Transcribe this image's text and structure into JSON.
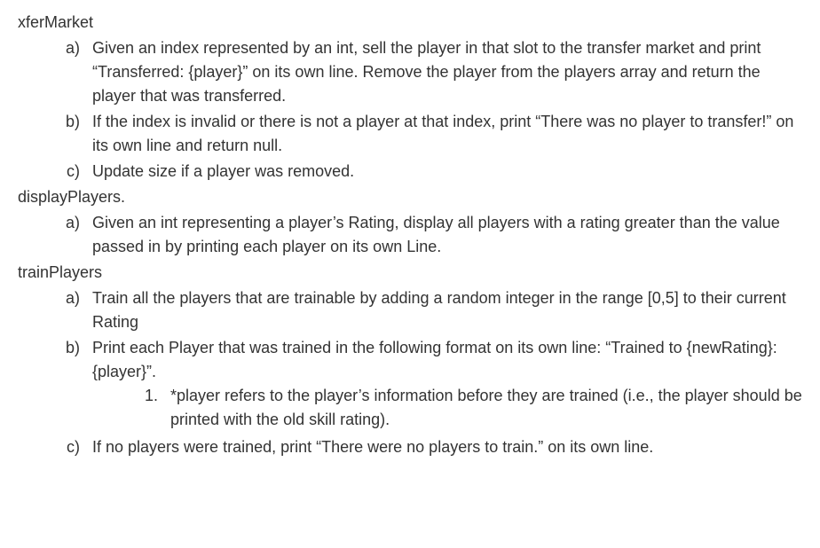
{
  "sections": [
    {
      "title": "xferMarket",
      "items": [
        {
          "marker": "a)",
          "text": "Given an index represented by an int, sell the player in that slot to the transfer market and print “Transferred: {player}” on its own line. Remove the player from the players array and return the player that was transferred."
        },
        {
          "marker": "b)",
          "text": "If the index is invalid or there is not a player at that index, print “There was no player to transfer!” on its own line and return null."
        },
        {
          "marker": "c)",
          "text": "Update size if a player was removed."
        }
      ]
    },
    {
      "title": "displayPlayers.",
      "items": [
        {
          "marker": "a)",
          "text": "Given an int representing a player’s Rating, display all players with a rating greater than the value passed in by printing each player on its own Line."
        }
      ]
    },
    {
      "title": "trainPlayers",
      "items": [
        {
          "marker": "a)",
          "text": "Train all the players that are trainable by adding a random integer in the range [0,5] to their current Rating"
        },
        {
          "marker": "b)",
          "text": "Print each Player that was trained in the following format on its own line: “Trained to {newRating}: {player}”.",
          "subitems": [
            {
              "marker": "1.",
              "text": "*player refers to the player’s information before they are trained (i.e., the player should be printed with the old skill rating)."
            }
          ]
        },
        {
          "marker": "c)",
          "text": "If no players were trained, print “There were no players to train.” on its own line."
        }
      ]
    }
  ]
}
